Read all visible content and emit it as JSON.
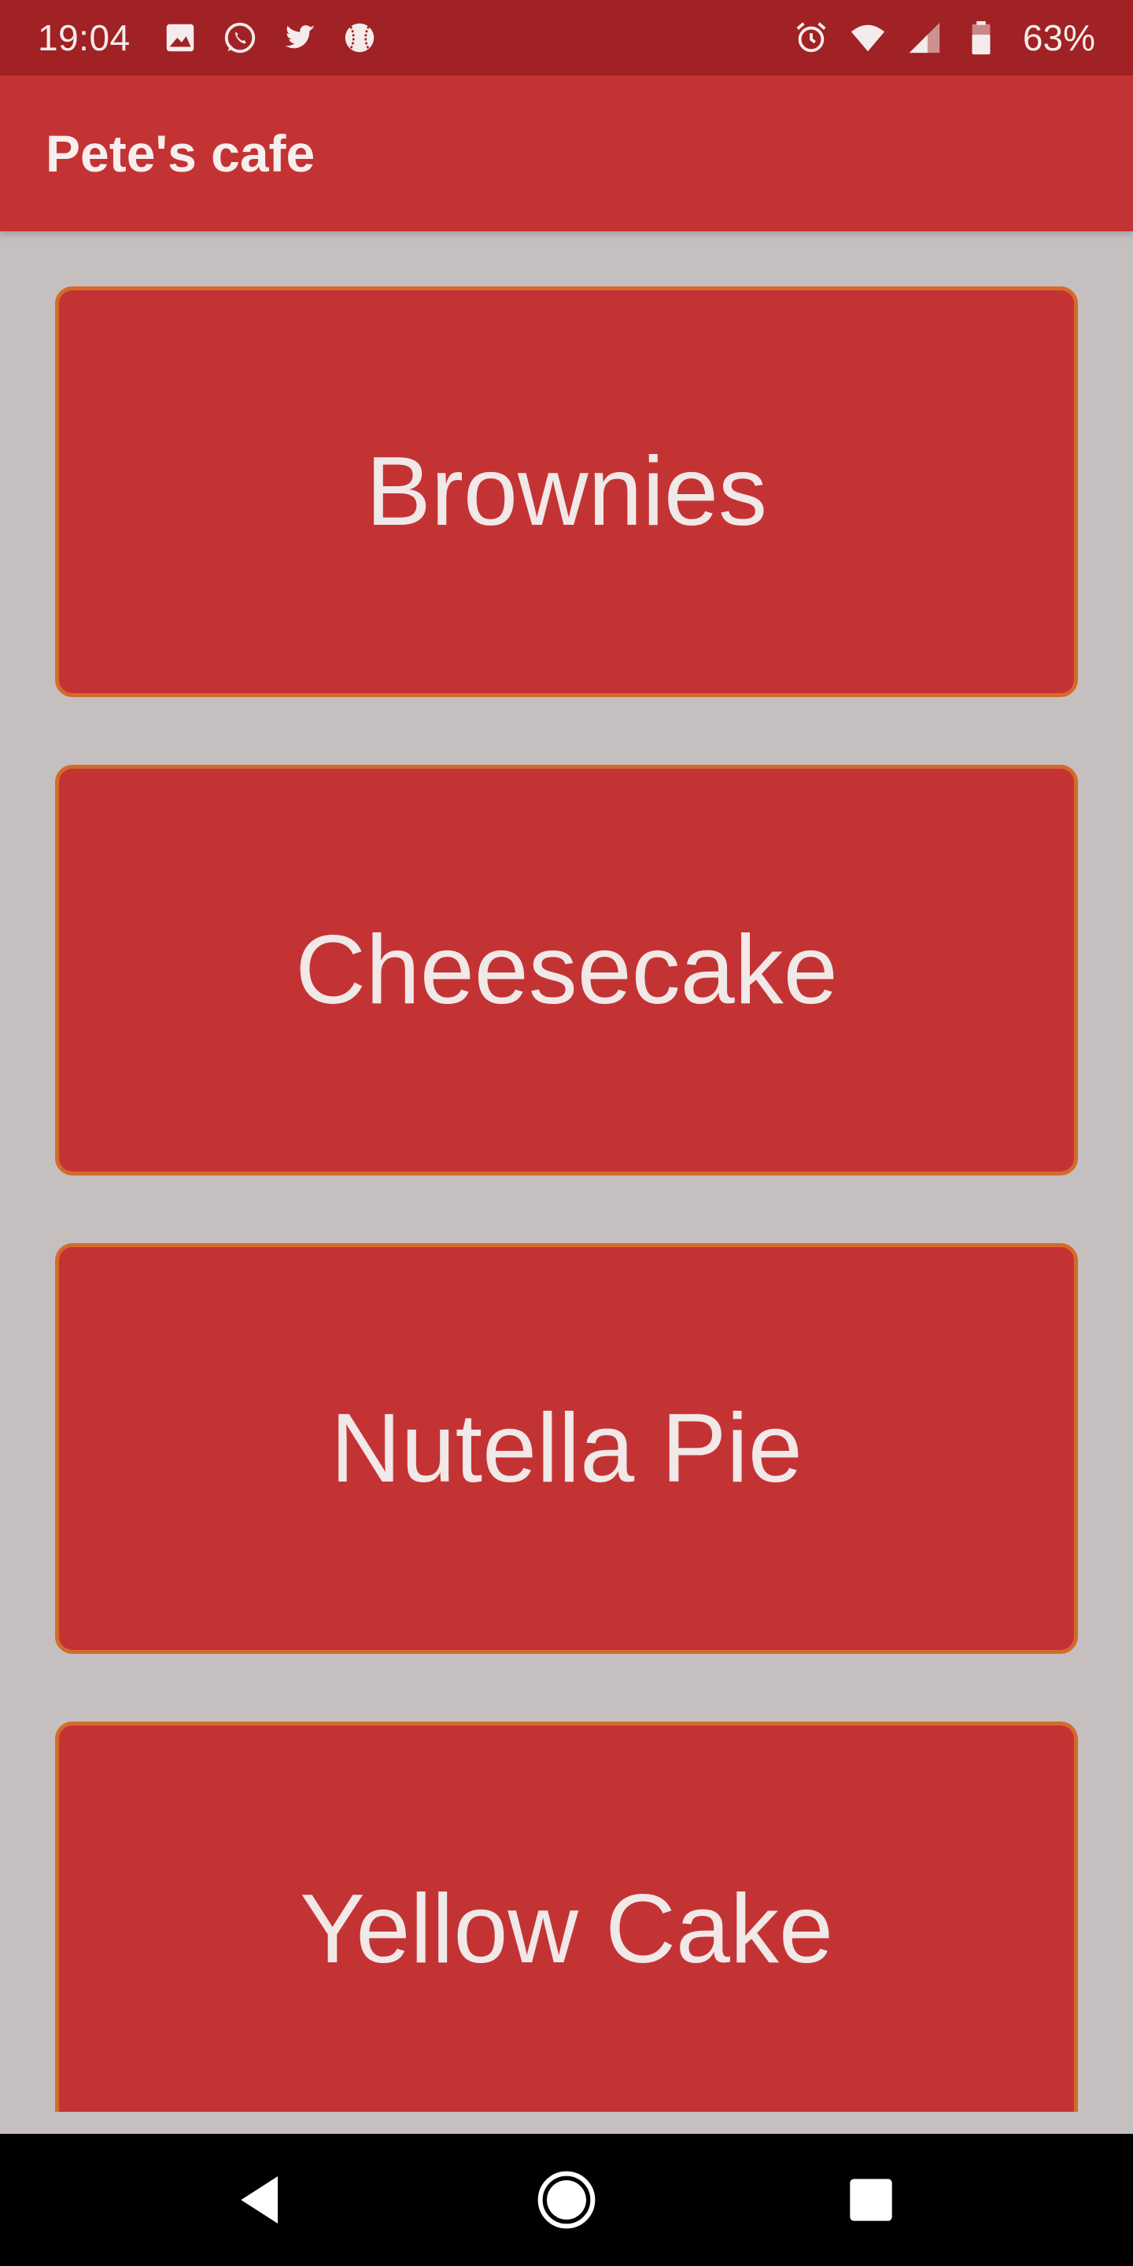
{
  "status_bar": {
    "time": "19:04",
    "battery": "63%",
    "left_icons": [
      "image-icon",
      "whatsapp-icon",
      "twitter-icon",
      "baseball-icon"
    ],
    "right_icons": [
      "alarm-icon",
      "wifi-icon",
      "cell-signal-icon",
      "battery-icon"
    ]
  },
  "app_bar": {
    "title": "Pete's cafe"
  },
  "menu": {
    "items": [
      {
        "label": "Brownies"
      },
      {
        "label": "Cheesecake"
      },
      {
        "label": "Nutella Pie"
      },
      {
        "label": "Yellow Cake"
      }
    ]
  },
  "nav_bar": {
    "buttons": [
      "back-icon",
      "home-icon",
      "recents-icon"
    ]
  },
  "colors": {
    "status_bar": "#a02224",
    "app_bar": "#c43334",
    "card": "#c43334",
    "card_border": "#d46a2c",
    "background": "#c6bfbf"
  }
}
